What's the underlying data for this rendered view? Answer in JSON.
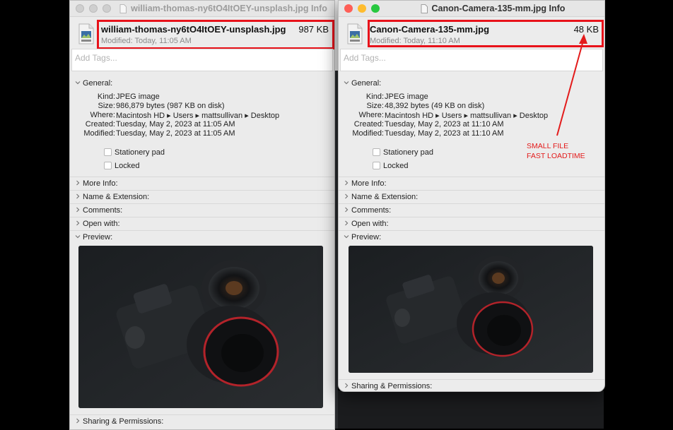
{
  "left_window": {
    "title": "william-thomas-ny6tO4ItOEY-unsplash.jpg Info",
    "file_name": "william-thomas-ny6tO4ItOEY-unsplash.jpg",
    "file_size": "987 KB",
    "modified_short": "Modified: Today, 11:05 AM",
    "tags_placeholder": "Add Tags...",
    "general_label": "General:",
    "kind_key": "Kind:",
    "kind_val": "JPEG image",
    "size_key": "Size:",
    "size_val": "986,879 bytes (987 KB on disk)",
    "where_key": "Where:",
    "where_val": "Macintosh HD ▸ Users ▸ mattsullivan ▸ Desktop",
    "created_key": "Created:",
    "created_val": "Tuesday, May 2, 2023 at 11:05 AM",
    "modified_key": "Modified:",
    "modified_val": "Tuesday, May 2, 2023 at 11:05 AM",
    "stationery_label": "Stationery pad",
    "locked_label": "Locked",
    "more_info": "More Info:",
    "name_ext": "Name & Extension:",
    "comments": "Comments:",
    "open_with": "Open with:",
    "preview": "Preview:",
    "sharing": "Sharing & Permissions:"
  },
  "right_window": {
    "title": "Canon-Camera-135-mm.jpg Info",
    "file_name": "Canon-Camera-135-mm.jpg",
    "file_size": "48 KB",
    "modified_short": "Modified: Today, 11:10 AM",
    "tags_placeholder": "Add Tags...",
    "general_label": "General:",
    "kind_key": "Kind:",
    "kind_val": "JPEG image",
    "size_key": "Size:",
    "size_val": "48,392 bytes (49 KB on disk)",
    "where_key": "Where:",
    "where_val": "Macintosh HD ▸ Users ▸ mattsullivan ▸ Desktop",
    "created_key": "Created:",
    "created_val": "Tuesday, May 2, 2023 at 11:10 AM",
    "modified_key": "Modified:",
    "modified_val": "Tuesday, May 2, 2023 at 11:10 AM",
    "stationery_label": "Stationery pad",
    "locked_label": "Locked",
    "more_info": "More Info:",
    "name_ext": "Name & Extension:",
    "comments": "Comments:",
    "open_with": "Open with:",
    "preview": "Preview:",
    "sharing": "Sharing & Permissions:"
  },
  "annotation": {
    "line1": "SMALL FILE",
    "line2": "FAST LOADTIME",
    "color": "#e31b1b"
  },
  "colors": {
    "highlight": "#e8121a",
    "window_bg": "#ececec",
    "close": "#fe5f57",
    "minimize": "#febc2e",
    "maximize": "#28c840"
  },
  "icons": {
    "file": "jpeg-document-icon",
    "chevron_right": "chevron-right-icon",
    "chevron_down": "chevron-down-icon"
  }
}
